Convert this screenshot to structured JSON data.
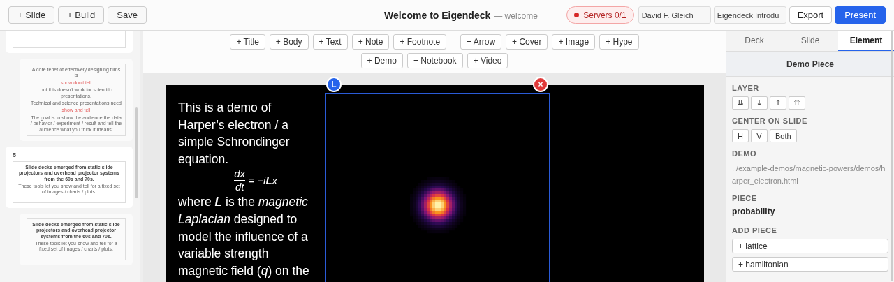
{
  "toolbar": {
    "buttons": [
      "+ Slide",
      "+ Build",
      "Save"
    ]
  },
  "title": {
    "name": "Welcome to Eigendeck",
    "subtitle": "— welcome"
  },
  "servers": {
    "label": "Servers 0/1",
    "connected": false
  },
  "author_field": {
    "value": "David F. Gleich"
  },
  "deck_field": {
    "value": "Eigendeck Introdu"
  },
  "actions": [
    {
      "label": "Export",
      "primary": false
    },
    {
      "label": "Present",
      "primary": true
    }
  ],
  "thumbnails": [
    {
      "kind": "slide"
    },
    {
      "kind": "build",
      "lines": [
        {
          "text": "A core tenet of effectively designing films is",
          "accent": false
        },
        {
          "text": "show don't tell",
          "accent": true
        },
        {
          "text": "but this doesn't work for scientific presentations.",
          "accent": false
        },
        {
          "text": "Technical and science presentations need",
          "accent": false
        },
        {
          "text": "show and tell",
          "accent": true
        },
        {
          "text": "The goal is to show the audience the data / behavior / experiment / result and tell the audience what you think it means!",
          "accent": false
        }
      ]
    },
    {
      "kind": "slide",
      "number": "5",
      "heading": "Slide decks emerged from static slide projectors and overhead projector systems from the 60s and 70s.",
      "lines": [
        {
          "text": "These tools let you show and tell for a fixed set of images / charts / plots.",
          "accent": false
        }
      ]
    },
    {
      "kind": "build",
      "heading": "Slide decks emerged from static slide projectors and overhead projector systems from the 60s and 70s.",
      "lines": [
        {
          "text": "These tools let you show and tell for a fixed set of images / charts / plots.",
          "accent": false
        }
      ]
    }
  ],
  "insert_rows": [
    [
      "+ Title",
      "+ Body",
      "+ Text",
      "+ Note",
      "+ Footnote",
      "+ Arrow",
      "+ Cover",
      "+ Image",
      "+ Hype"
    ],
    [
      "+ Demo",
      "+ Notebook",
      "+ Video"
    ]
  ],
  "slide": {
    "intro": "This is a demo of Harper’s electron / a simple Schrondinger equation.",
    "equation": {
      "numerator": "dx",
      "denominator": "dt",
      "rhs": "= −i**L**x"
    },
    "body": "where **L** is the *magnetic Laplacian* designed to model the influence of a variable strength magnetic field (*q*) on the",
    "selection": {
      "layer_badge": "L",
      "delete": "×"
    }
  },
  "panel": {
    "tabs": [
      {
        "label": "Deck",
        "selected": false
      },
      {
        "label": "Slide",
        "selected": false
      },
      {
        "label": "Element",
        "selected": true
      }
    ],
    "header": "Demo Piece",
    "layer": {
      "label": "LAYER",
      "buttons": [
        "⇊",
        "↓",
        "↑",
        "⇈"
      ]
    },
    "center": {
      "label": "CENTER ON SLIDE",
      "buttons": [
        "H",
        "V",
        "Both"
      ]
    },
    "demo": {
      "label": "DEMO",
      "path": "../example-demos/magnetic-powers/demos/harper_electron.html"
    },
    "piece": {
      "label": "PIECE",
      "value": "probability"
    },
    "add_piece": {
      "label": "ADD PIECE",
      "buttons": [
        "+ lattice",
        "+ hamiltonian"
      ]
    }
  }
}
